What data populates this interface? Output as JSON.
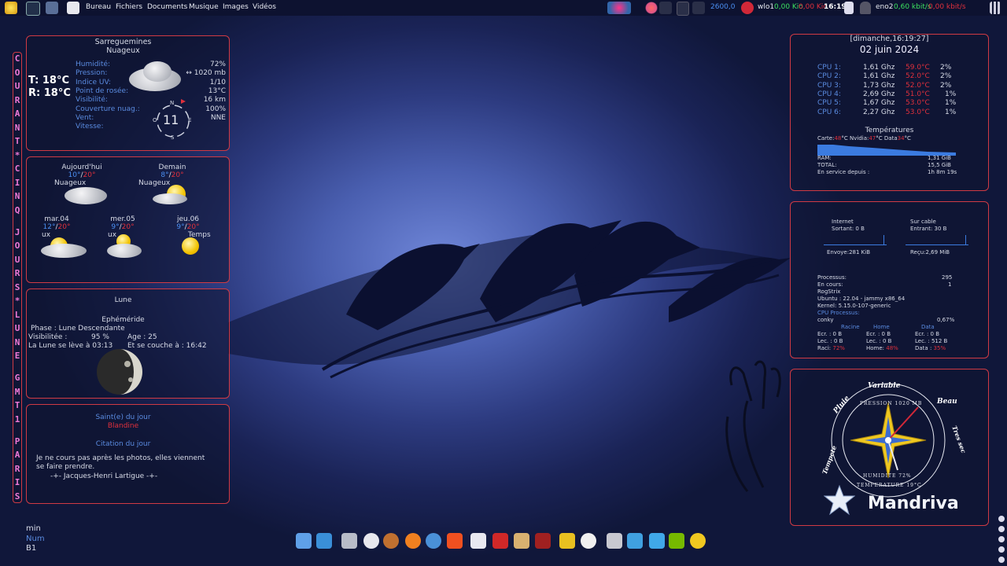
{
  "topbar": {
    "menus": [
      "Bureau",
      "Fichiers",
      "Documents",
      "Musique",
      "Images",
      "Vidéos"
    ],
    "freq": "2600,0",
    "wifi": {
      "name": "wlo1",
      "up": "0,00 Kio",
      "down": "0,00 Kio"
    },
    "clock": "16:19",
    "eth": {
      "name": "eno2",
      "up": "0,60 kbit/s",
      "down": "0,00 kbit/s"
    }
  },
  "vertical_text": "COURANT*CINQ JOURS*LUNE GMT1 PARIS",
  "weather": {
    "city": "Sarreguemines",
    "condition": "Nuageux",
    "temp": "T: 18°C",
    "feel": "R: 18°C",
    "rows": [
      {
        "label": "Humidité:",
        "value": "72%"
      },
      {
        "label": "Pression:",
        "value": "↔ 1020 mb"
      },
      {
        "label": "Indice UV:",
        "value": "1/10"
      },
      {
        "label": "Point de rosée:",
        "value": "13°C"
      },
      {
        "label": "Visibilité:",
        "value": "16 km"
      },
      {
        "label": "Couverture nuag.:",
        "value": "100%"
      },
      {
        "label": "Vent:",
        "value": "NNE"
      },
      {
        "label": "Vitesse:",
        "value": ""
      }
    ],
    "compass": {
      "n": "N",
      "s": "S",
      "e": "E",
      "o": "O",
      "speed": "11"
    }
  },
  "forecast": {
    "today": {
      "label": "Aujourd'hui",
      "low": "10°",
      "high": "20°",
      "cond": "Nuageux"
    },
    "tomorrow": {
      "label": "Demain",
      "low": "8°",
      "high": "20°",
      "cond": "Nuageux"
    },
    "days": [
      {
        "label": "mar.04",
        "low": "12°",
        "high": "20°",
        "cond": "ux"
      },
      {
        "label": "mer.05",
        "low": "9°",
        "high": "20°",
        "cond": "ux"
      },
      {
        "label": "jeu.06",
        "low": "9°",
        "high": "20°",
        "cond": "Temps"
      }
    ]
  },
  "moon": {
    "title": "Lune",
    "sub": "Ephéméride",
    "phase_label": "Phase :",
    "phase": "Lune Descendante",
    "vis_label": "Visibilitée :",
    "vis": "95 %",
    "age": "Age : 25",
    "rise": "La Lune se lève à",
    "rise_time": "03:13",
    "set": "Et se couche à",
    "set_time": ": 16:42"
  },
  "saint": {
    "title": "Saint(e) du jour",
    "name": "Blandine",
    "quote_title": "Citation du jour",
    "quote1": "Je ne cours pas après les photos, elles viennent",
    "quote2": "se faire prendre.",
    "author": "-+- Jacques-Henri Lartigue -+-"
  },
  "bottomleft": {
    "l1": "min",
    "l2": "Num",
    "l3": "B1"
  },
  "sys": {
    "datetime": "[dimanche,16:19:27]",
    "date": "02 juin 2024",
    "cpus": [
      {
        "n": "CPU 1:",
        "f": "1,61 Ghz",
        "t": "59.0°C",
        "p": "2%"
      },
      {
        "n": "CPU 2:",
        "f": "1,61 Ghz",
        "t": "52.0°C",
        "p": "2%"
      },
      {
        "n": "CPU 3:",
        "f": "1,73 Ghz",
        "t": "52.0°C",
        "p": "2%"
      },
      {
        "n": "CPU 4:",
        "f": "2,69 Ghz",
        "t": "51.0°C",
        "p": "1%"
      },
      {
        "n": "CPU 5:",
        "f": "1,67 Ghz",
        "t": "53.0°C",
        "p": "1%"
      },
      {
        "n": "CPU 6:",
        "f": "2,27 Ghz",
        "t": "53.0°C",
        "p": "1%"
      }
    ],
    "temps_title": "Températures",
    "temps": {
      "carte_l": "Carte:",
      "carte": "48",
      "nv_l": "°C  Nvidia:",
      "nv": "47",
      "data_l": "°C  Data",
      "data": "34",
      "end": "°C"
    },
    "ram_l": "RAM:",
    "ram": "1,31 GiB",
    "total_l": "TOTAL:",
    "total": "15,5 GiB",
    "up_l": "En service depuis :",
    "up": "1h 8m 19s"
  },
  "net": {
    "internet": "Internet",
    "sortant": "Sortant: 0 B",
    "surcable": "Sur cable",
    "entrant": "Entrant: 30 B",
    "envoye": "Envoye:281 KiB",
    "recu": "Reçu:2,69 MiB",
    "proc_l": "Processus:",
    "proc": "295",
    "cours_l": "En cours:",
    "cours": "1",
    "host": "RogStrix",
    "ubuntu": "Ubuntu : 22.04 - jammy  x86_64",
    "kernel": "Kernel: 5.15.0-107-generic",
    "cpuproc": "CPU Processus:",
    "conky": "conky",
    "conky_v": "0,67%",
    "disks": {
      "h1": "Racine",
      "h2": "Home",
      "h3": "Data",
      "r": [
        "Ecr. : 0 B",
        "Lec. : 0 B",
        "Raci: ",
        "72%"
      ],
      "h": [
        "Ecr. : 0 B",
        "Lec. : 0 B",
        "Home: ",
        "48%"
      ],
      "d": [
        "Ecr. : 0 B",
        "Lec. : 512 B",
        "Data : ",
        "35%"
      ]
    }
  },
  "baro": {
    "top": "Variable",
    "right": "Beau",
    "right2": "Tres sec",
    "left": "Pluie",
    "left2": "Tempete",
    "pression": "PRESSION 1020 MB",
    "humid": "HUMIDITE 72%",
    "temp": "TEMPERATURE 19°C",
    "brand": "Mandriva"
  },
  "colors": {
    "accent": "#d03a44",
    "label": "#5a8be0",
    "vertical": "#f07ad8"
  }
}
